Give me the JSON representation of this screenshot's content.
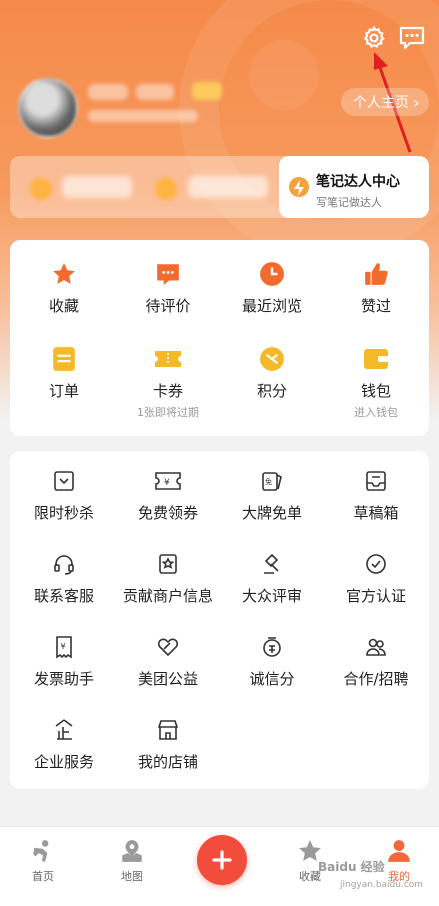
{
  "header": {
    "personal_home": "个人主页",
    "expert_title": "笔记达人中心",
    "expert_sub": "写笔记做达人"
  },
  "quick": [
    {
      "label": "收藏",
      "icon": "star-icon"
    },
    {
      "label": "待评价",
      "icon": "comment-icon"
    },
    {
      "label": "最近浏览",
      "icon": "clock-icon"
    },
    {
      "label": "赞过",
      "icon": "thumb-up-icon"
    },
    {
      "label": "订单",
      "icon": "order-icon"
    },
    {
      "label": "卡券",
      "icon": "ticket-icon",
      "sub": "1张即将过期"
    },
    {
      "label": "积分",
      "icon": "points-icon"
    },
    {
      "label": "钱包",
      "icon": "wallet-icon",
      "sub": "进入钱包"
    }
  ],
  "services": [
    {
      "label": "限时秒杀",
      "icon": "flash-sale-icon"
    },
    {
      "label": "免费领券",
      "icon": "coupon-icon"
    },
    {
      "label": "大牌免单",
      "icon": "free-order-icon"
    },
    {
      "label": "草稿箱",
      "icon": "drafts-icon"
    },
    {
      "label": "联系客服",
      "icon": "headset-icon"
    },
    {
      "label": "贡献商户信息",
      "icon": "merchant-info-icon"
    },
    {
      "label": "大众评审",
      "icon": "gavel-icon"
    },
    {
      "label": "官方认证",
      "icon": "verified-icon"
    },
    {
      "label": "发票助手",
      "icon": "invoice-icon"
    },
    {
      "label": "美团公益",
      "icon": "charity-icon"
    },
    {
      "label": "诚信分",
      "icon": "credit-icon"
    },
    {
      "label": "合作/招聘",
      "icon": "people-icon"
    },
    {
      "label": "企业服务",
      "icon": "enterprise-icon"
    },
    {
      "label": "我的店铺",
      "icon": "store-icon"
    }
  ],
  "tabs": [
    {
      "label": "首页",
      "icon": "home-icon"
    },
    {
      "label": "地图",
      "icon": "map-icon"
    },
    {
      "label": "收藏",
      "icon": "star-icon"
    },
    {
      "label": "我的",
      "icon": "user-icon"
    }
  ],
  "watermark": {
    "line1": "Baidu 经验",
    "line2": "jingyan.baidu.com"
  },
  "colors": {
    "accent": "#f2683a",
    "brand_orange": "#f58a4a",
    "plus_red": "#f24c3d"
  }
}
